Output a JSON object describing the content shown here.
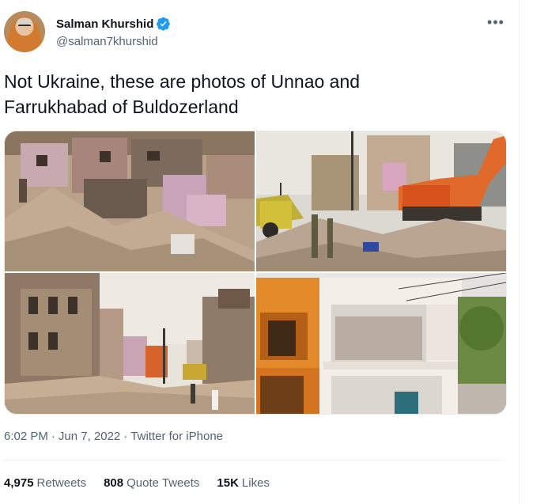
{
  "author": {
    "display_name": "Salman Khurshid",
    "handle": "@salman7khurshid",
    "verified_icon": "verified-badge-icon",
    "accent_color": "#1d9bf0"
  },
  "more_icon": "•••",
  "tweet": {
    "text": "Not Ukraine, these are photos of Unnao and\nFarrukhabad of Buldozerland"
  },
  "media": {
    "count": 4,
    "items": [
      {
        "name": "demolished-building-rubble-photo"
      },
      {
        "name": "bulldozer-demolition-site-photo"
      },
      {
        "name": "street-demolished-houses-photo"
      },
      {
        "name": "partially-demolished-building-photo"
      }
    ]
  },
  "meta": {
    "time": "6:02 PM",
    "separator1": "·",
    "date": "Jun 7, 2022",
    "separator2": "·",
    "source": "Twitter for iPhone"
  },
  "stats": {
    "retweets_count": "4,975",
    "retweets_label": "Retweets",
    "quote_count": "808",
    "quote_label": "Quote Tweets",
    "likes_count": "15K",
    "likes_label": "Likes"
  }
}
